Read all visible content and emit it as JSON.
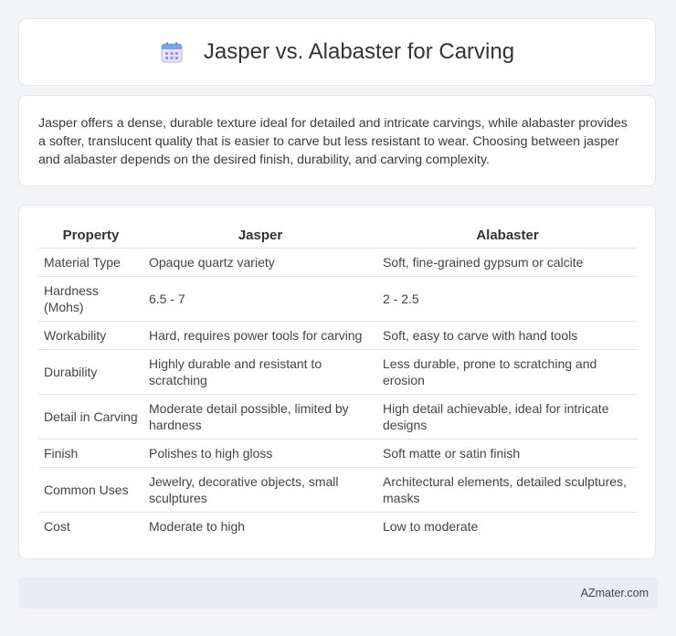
{
  "header": {
    "title": "Jasper vs. Alabaster for Carving",
    "icon": "calendar-icon"
  },
  "intro": "Jasper offers a dense, durable texture ideal for detailed and intricate carvings, while alabaster provides a softer, translucent quality that is easier to carve but less resistant to wear. Choosing between jasper and alabaster depends on the desired finish, durability, and carving complexity.",
  "table": {
    "headers": [
      "Property",
      "Jasper",
      "Alabaster"
    ],
    "rows": [
      [
        "Material Type",
        "Opaque quartz variety",
        "Soft, fine-grained gypsum or calcite"
      ],
      [
        "Hardness (Mohs)",
        "6.5 - 7",
        "2 - 2.5"
      ],
      [
        "Workability",
        "Hard, requires power tools for carving",
        "Soft, easy to carve with hand tools"
      ],
      [
        "Durability",
        "Highly durable and resistant to scratching",
        "Less durable, prone to scratching and erosion"
      ],
      [
        "Detail in Carving",
        "Moderate detail possible, limited by hardness",
        "High detail achievable, ideal for intricate designs"
      ],
      [
        "Finish",
        "Polishes to high gloss",
        "Soft matte or satin finish"
      ],
      [
        "Common Uses",
        "Jewelry, decorative objects, small sculptures",
        "Architectural elements, detailed sculptures, masks"
      ],
      [
        "Cost",
        "Moderate to high",
        "Low to moderate"
      ]
    ]
  },
  "footer": {
    "brand": "AZmater.com"
  }
}
